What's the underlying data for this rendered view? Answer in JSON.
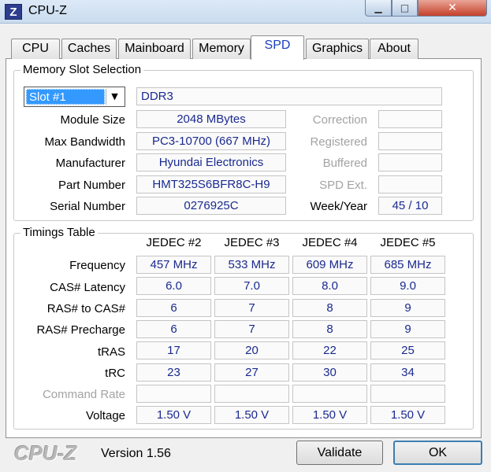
{
  "window": {
    "icon_letter": "Z",
    "title": "CPU-Z",
    "min_glyph": "▁",
    "max_glyph": "□",
    "close_glyph": "✕"
  },
  "tabs": [
    "CPU",
    "Caches",
    "Mainboard",
    "Memory",
    "SPD",
    "Graphics",
    "About"
  ],
  "active_tab": "SPD",
  "slot_selection": {
    "title": "Memory Slot Selection",
    "slot_value": "Slot #1",
    "memory_type": "DDR3",
    "rows": [
      {
        "label": "Module Size",
        "value": "2048 MBytes",
        "right_label": "Correction",
        "right_value": ""
      },
      {
        "label": "Max Bandwidth",
        "value": "PC3-10700 (667 MHz)",
        "right_label": "Registered",
        "right_value": ""
      },
      {
        "label": "Manufacturer",
        "value": "Hyundai Electronics",
        "right_label": "Buffered",
        "right_value": ""
      },
      {
        "label": "Part Number",
        "value": "HMT325S6BFR8C-H9",
        "right_label": "SPD Ext.",
        "right_value": ""
      },
      {
        "label": "Serial Number",
        "value": "0276925C",
        "right_label": "Week/Year",
        "right_value": "45 / 10"
      }
    ]
  },
  "timings": {
    "title": "Timings Table",
    "columns": [
      "JEDEC #2",
      "JEDEC #3",
      "JEDEC #4",
      "JEDEC #5"
    ],
    "rows": [
      {
        "label": "Frequency",
        "values": [
          "457 MHz",
          "533 MHz",
          "609 MHz",
          "685 MHz"
        ]
      },
      {
        "label": "CAS# Latency",
        "values": [
          "6.0",
          "7.0",
          "8.0",
          "9.0"
        ]
      },
      {
        "label": "RAS# to CAS#",
        "values": [
          "6",
          "7",
          "8",
          "9"
        ]
      },
      {
        "label": "RAS# Precharge",
        "values": [
          "6",
          "7",
          "8",
          "9"
        ]
      },
      {
        "label": "tRAS",
        "values": [
          "17",
          "20",
          "22",
          "25"
        ]
      },
      {
        "label": "tRC",
        "values": [
          "23",
          "27",
          "30",
          "34"
        ]
      },
      {
        "label": "Command Rate",
        "values": [
          "",
          "",
          "",
          ""
        ]
      },
      {
        "label": "Voltage",
        "values": [
          "1.50 V",
          "1.50 V",
          "1.50 V",
          "1.50 V"
        ]
      }
    ]
  },
  "footer": {
    "logo": "CPU-Z",
    "version": "Version 1.56",
    "validate_label": "Validate",
    "ok_label": "OK"
  }
}
